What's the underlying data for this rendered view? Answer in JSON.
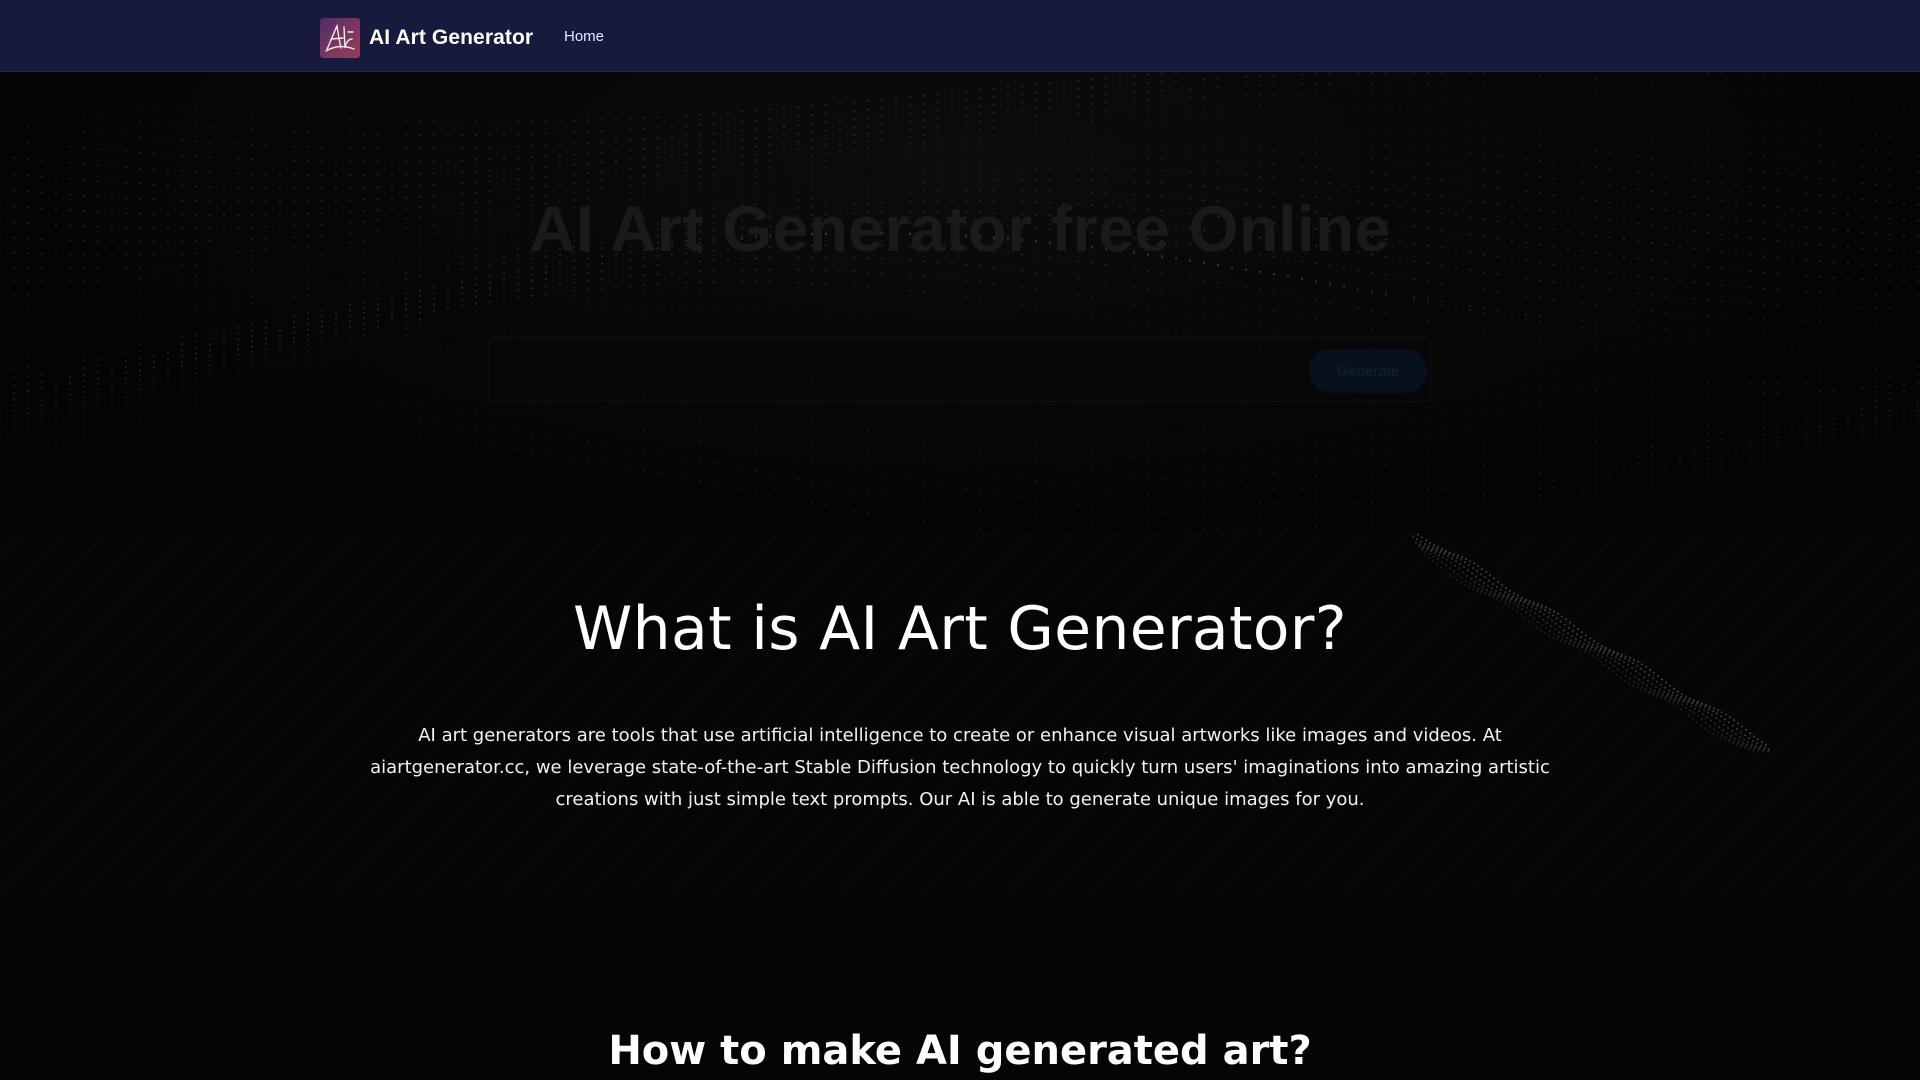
{
  "header": {
    "brand_name": "AI Art Generator",
    "logo_icon": "signature-logo-icon",
    "nav": [
      {
        "label": "Home"
      }
    ]
  },
  "hero": {
    "title": "AI Art Generator free Online",
    "subtitle": "",
    "prompt": {
      "value": "",
      "placeholder": ""
    },
    "generate_label": "Generate"
  },
  "what_section": {
    "title": "What is AI Art Generator?",
    "description": "AI art generators are tools that use artificial intelligence to create or enhance visual artworks like images and videos. At aiartgenerator.cc, we leverage state-of-the-art Stable Diffusion technology to quickly turn users' imaginations into amazing artistic creations with just simple text prompts. Our AI is able to generate unique images for you."
  },
  "how_section": {
    "title": "How to make AI generated art?"
  },
  "colors": {
    "navbar_bg": "#161a3d",
    "page_bg": "#050505",
    "text": "#ffffff"
  }
}
